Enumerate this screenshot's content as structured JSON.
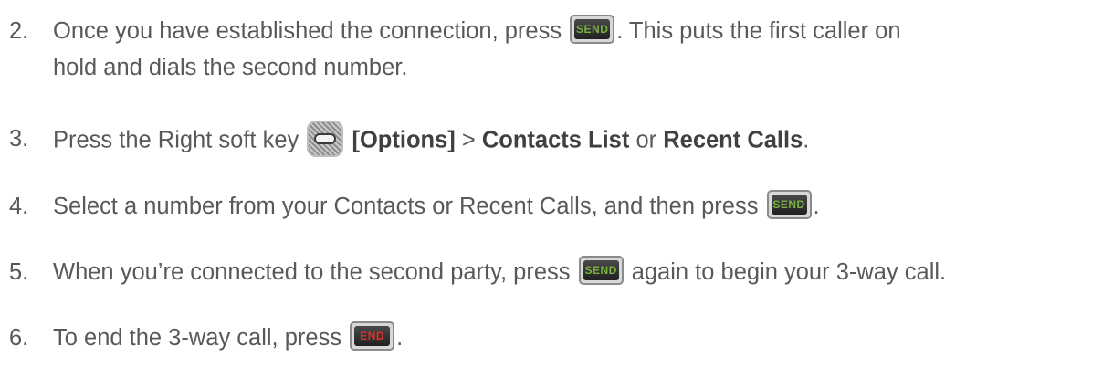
{
  "steps": [
    {
      "number": "2.",
      "part1": "Once you have established the connection, press ",
      "key": "SEND",
      "part2": ". This puts the first caller on",
      "line2": "hold and dials the second number."
    },
    {
      "number": "3.",
      "part1": "Press the Right soft key ",
      "bold1": "[Options]",
      "sep1": " > ",
      "bold2": "Contacts List",
      "sep2": " or ",
      "bold3": "Recent Calls",
      "end": "."
    },
    {
      "number": "4.",
      "part1": "Select a number from your Contacts or Recent Calls, and then press ",
      "key": "SEND",
      "part2": "."
    },
    {
      "number": "5.",
      "part1": "When you’re connected to the second party, press ",
      "key": "SEND",
      "part2": " again to begin your 3-way call."
    },
    {
      "number": "6.",
      "part1": "To end the 3-way call, press ",
      "key": "END",
      "part2": "."
    }
  ],
  "colors": {
    "send_key_text": "#79b042",
    "end_key_text": "#e0302a"
  },
  "icons": {
    "send": "send-key-icon",
    "end": "end-key-icon",
    "soft": "right-soft-key-icon"
  }
}
